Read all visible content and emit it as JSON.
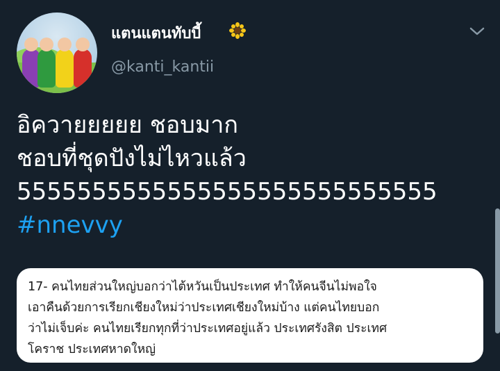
{
  "author": {
    "display_name": "แตนแตนทับบี้",
    "handle": "@kanti_kantii",
    "avatar_icon": "teletubbies-avatar",
    "badge_icon": "sunflower-icon"
  },
  "menu": {
    "icon": "chevron-down-icon"
  },
  "tweet": {
    "lines": [
      "อิควายยยยย ชอบมาก",
      "ชอบที่ชุดปังไม่ไหวแล้ว",
      "5555555555555555555555555555"
    ],
    "hashtag": "#nnevvy"
  },
  "quoted_image": {
    "lines": [
      "17- คนไทยส่วนใหญ่บอกว่าไต้หวันเป็นประเทศ ทำให้คนจีนไม่พอใจ",
      "เอาคืนด้วยการเรียกเชียงใหม่ว่าประเทศเชียงใหม่บ้าง แต่คนไทยบอก",
      "ว่าไม่เจ็บค่ะ คนไทยเรียกทุกที่ว่าประเทศอยู่แล้ว ประเทศรังสิต ประเทศ",
      "โคราช ประเทศหาดใหญ่"
    ]
  },
  "colors": {
    "background": "#15202b",
    "text": "#ffffff",
    "secondary_text": "#8899a6",
    "hashtag": "#1da1f2"
  }
}
